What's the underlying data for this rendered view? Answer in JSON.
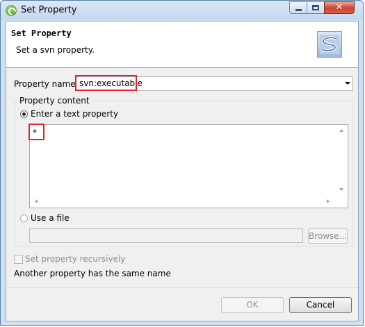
{
  "window": {
    "title": "Set Property",
    "app_icon": "eclipse-spring-icon",
    "controls": [
      "minimize-icon",
      "maximize-icon",
      "close-icon"
    ]
  },
  "header": {
    "title": "Set Property",
    "description": "Set a svn property.",
    "banner_icon": "svn-logo-icon"
  },
  "property_name": {
    "label": "Property name :",
    "value": "svn:executable"
  },
  "content_group": {
    "label": "Property content",
    "text_option": "Enter a text property",
    "text_value": "*",
    "file_option": "Use a file",
    "file_value": "",
    "browse_label": "Browse..."
  },
  "recursive": {
    "label": "Set property recursively",
    "checked": false
  },
  "message": "Another property has the same name",
  "buttons": {
    "ok": "OK",
    "cancel": "Cancel"
  },
  "colors": {
    "highlight": "#e8202a",
    "title_bar": "#c4d7ee",
    "close_button": "#c8432a"
  }
}
